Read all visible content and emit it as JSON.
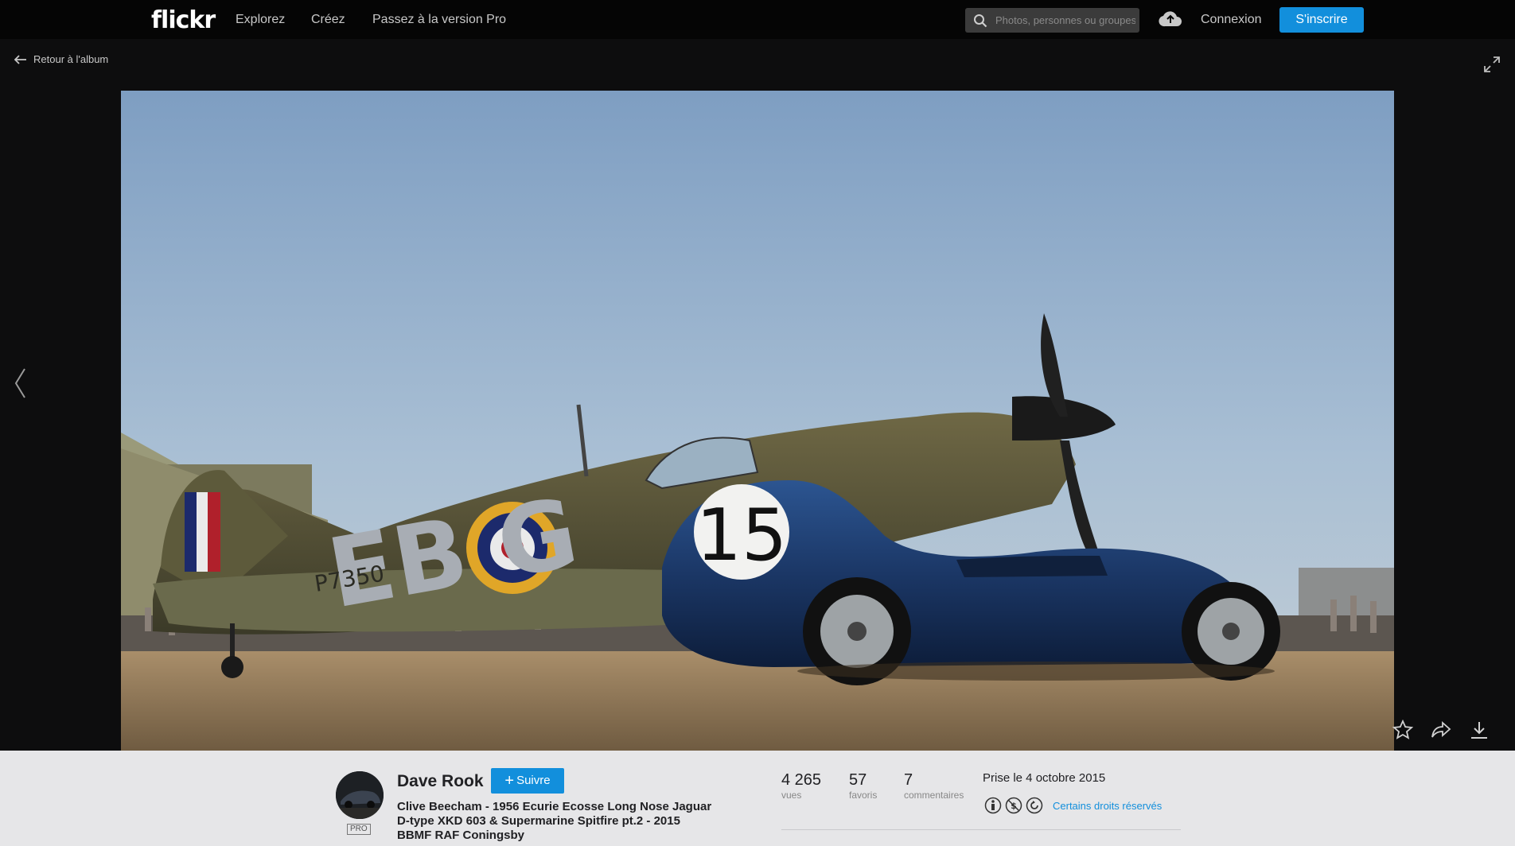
{
  "header": {
    "logo": "flickr",
    "nav": [
      "Explorez",
      "Créez",
      "Passez à la version Pro"
    ],
    "search_placeholder": "Photos, personnes ou groupes",
    "login": "Connexion",
    "signup": "S'inscrire"
  },
  "viewer": {
    "back_label": "Retour à l'album",
    "photo_text": {
      "car_number": "15",
      "plane_codes": "EB G",
      "plane_serial": "P7350"
    }
  },
  "info": {
    "owner": "Dave Rook",
    "pro_badge": "PRO",
    "follow_label": "Suivre",
    "title_lines": [
      "Clive Beecham - 1956 Ecurie Ecosse Long Nose Jaguar",
      "D-type XKD 603 & Supermarine Spitfire pt.2 - 2015",
      "BBMF RAF Coningsby"
    ],
    "stats": [
      {
        "value": "4 265",
        "label": "vues"
      },
      {
        "value": "57",
        "label": "favoris"
      },
      {
        "value": "7",
        "label": "commentaires"
      }
    ],
    "taken": "Prise le 4 octobre 2015",
    "license": "Certains droits réservés"
  },
  "colors": {
    "accent": "#128fdc",
    "topbar": "#050505",
    "panel": "#e6e6e8"
  }
}
